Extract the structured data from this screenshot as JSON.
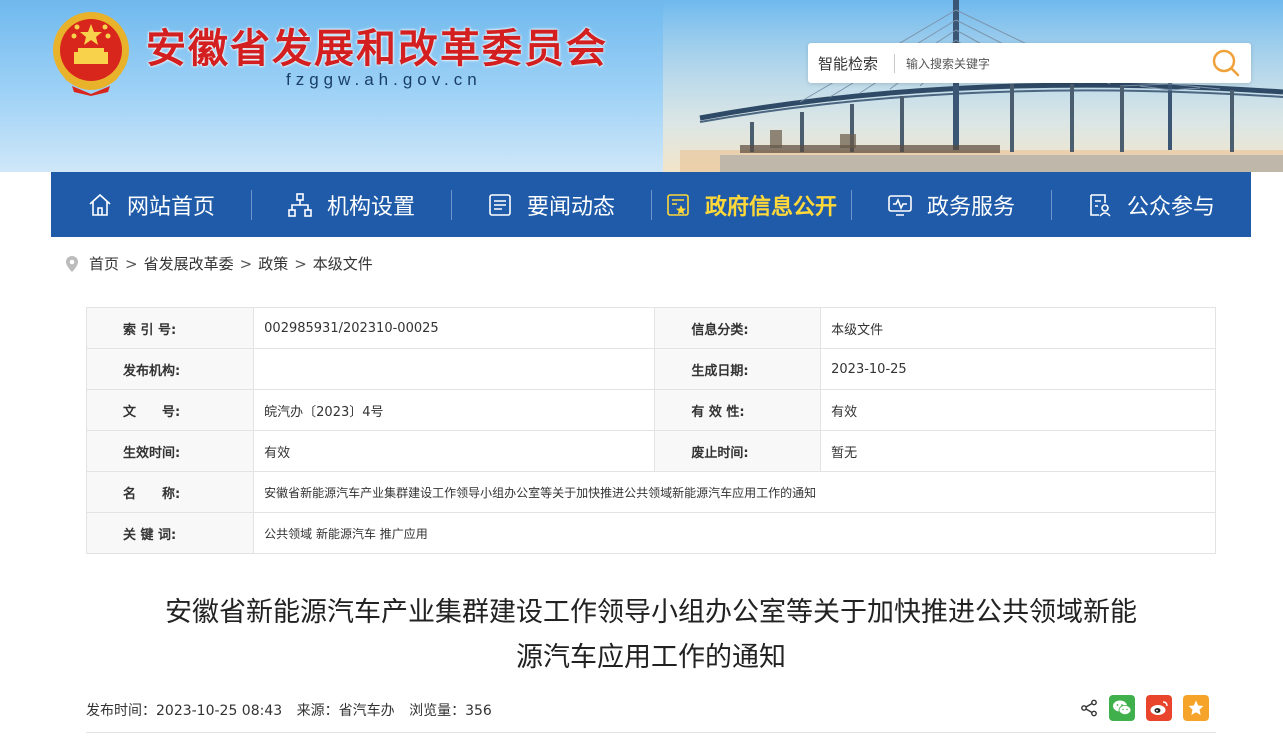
{
  "header": {
    "title": "安徽省发展和改革委员会",
    "domain": "fzggw.ah.gov.cn",
    "search": {
      "label": "智能检索",
      "placeholder": "输入搜索关键字"
    }
  },
  "nav": {
    "items": [
      {
        "label": "网站首页",
        "icon": "home-icon"
      },
      {
        "label": "机构设置",
        "icon": "org-chart-icon"
      },
      {
        "label": "要闻动态",
        "icon": "news-icon"
      },
      {
        "label": "政府信息公开",
        "icon": "gov-info-icon",
        "active": true
      },
      {
        "label": "政务服务",
        "icon": "monitor-service-icon"
      },
      {
        "label": "公众参与",
        "icon": "public-participation-icon"
      }
    ]
  },
  "breadcrumb": [
    "首页",
    "省发展改革委",
    "政策",
    "本级文件"
  ],
  "info": {
    "index_label": "索 引 号:",
    "index_value": "002985931/202310-00025",
    "category_label": "信息分类:",
    "category_value": "本级文件",
    "publisher_label": "发布机构:",
    "publisher_value": "",
    "created_label": "生成日期:",
    "created_value": "2023-10-25",
    "docno_label": "文　　号:",
    "docno_value": "皖汽办〔2023〕4号",
    "validity_label": "有 效 性:",
    "validity_value": "有效",
    "effective_label": "生效时间:",
    "effective_value": "有效",
    "expire_label": "废止时间:",
    "expire_value": "暂无",
    "name_label": "名　　称:",
    "name_value": "安徽省新能源汽车产业集群建设工作领导小组办公室等关于加快推进公共领域新能源汽车应用工作的通知",
    "keywords_label": "关 键 词:",
    "keywords_value": "公共领域 新能源汽车 推广应用"
  },
  "article": {
    "title_line1": "安徽省新能源汽车产业集群建设工作领导小组办公室等关于加快推进公共领域新能",
    "title_line2": "源汽车应用工作的通知",
    "publish_time": "发布时间：2023-10-25 08:43",
    "source": "来源：省汽车办",
    "views": "浏览量：356"
  },
  "colors": {
    "nav_bg": "#1f5ba8",
    "nav_active": "#ffd83a",
    "title_red": "#d31f1f",
    "wechat": "#3fb04b",
    "weibo": "#e8452c",
    "favorite": "#f6a32a"
  }
}
